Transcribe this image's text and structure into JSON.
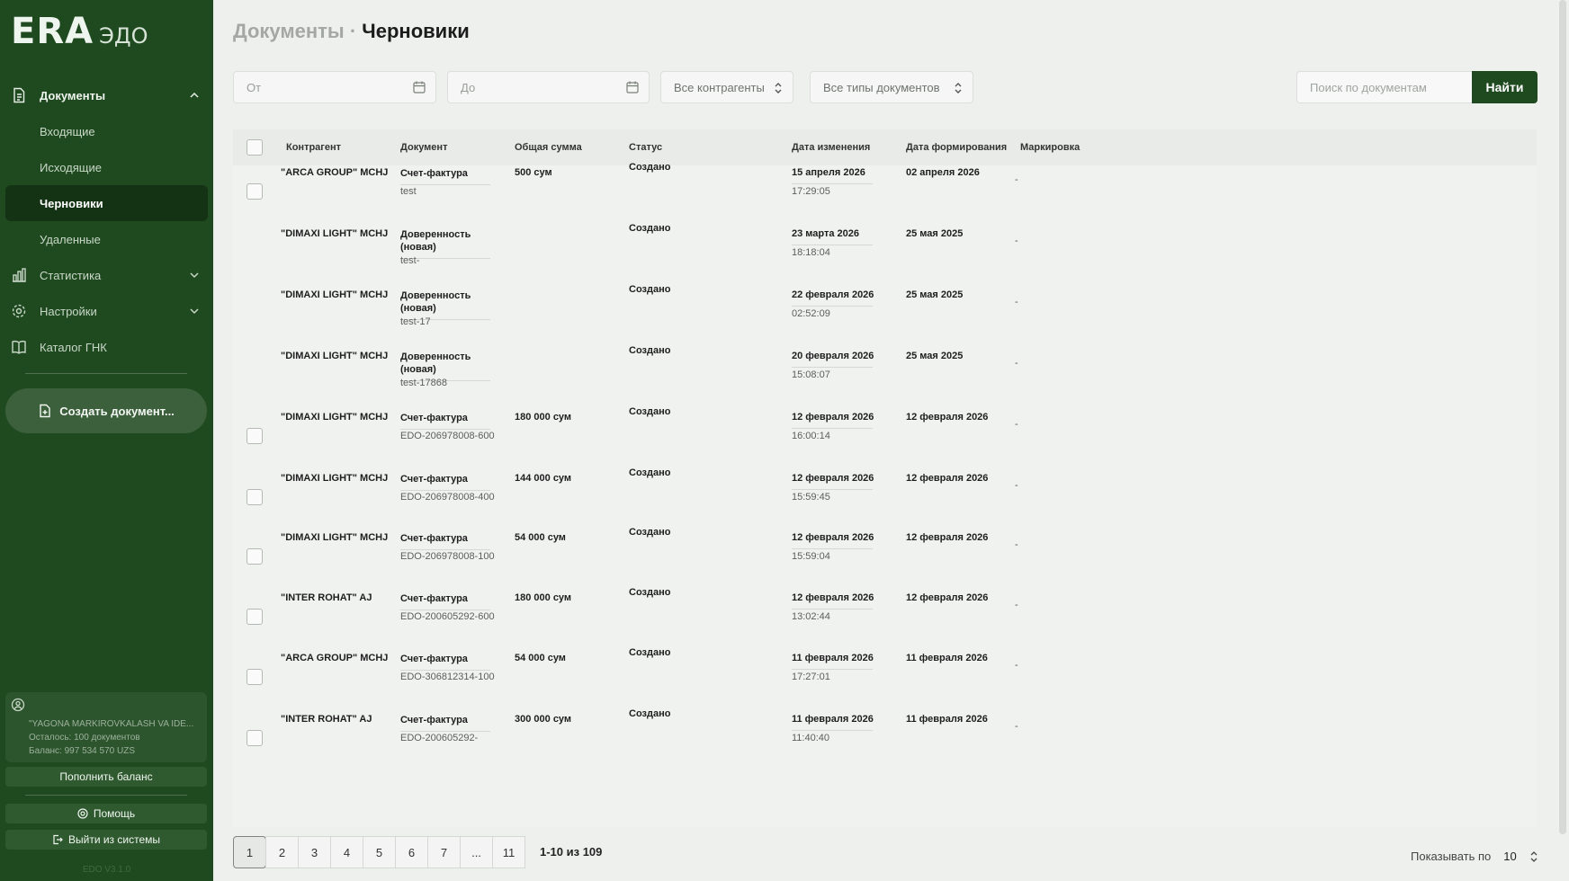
{
  "brand": {
    "logo": "ERA",
    "suffix": "ЭДО"
  },
  "sidebar": {
    "documents_label": "Документы",
    "sub": [
      "Входящие",
      "Исходящие",
      "Черновики",
      "Удаленные"
    ],
    "stats_label": "Статистика",
    "settings_label": "Настройки",
    "catalog_label": "Каталог ГНК",
    "create_label": "Создать документ...",
    "account": {
      "name": "\"YAGONA MARKIROVKALASH VA IDE...",
      "remaining": "Осталось: 100 документов",
      "balance": "Баланс: 997 534 570 UZS"
    },
    "topup_label": "Пополнить баланс",
    "help_label": "Помощь",
    "logout_label": "Выйти из системы",
    "version": "EDO V3.1.0"
  },
  "breadcrumb": {
    "section": "Документы",
    "sep": "·",
    "current": "Черновики"
  },
  "filters": {
    "from_placeholder": "От",
    "to_placeholder": "До",
    "contractors": "Все контрагенты",
    "doc_types": "Все типы документов",
    "search_placeholder": "Поиск по документам",
    "find_label": "Найти"
  },
  "table": {
    "headers": [
      "Контрагент",
      "Документ",
      "Общая сумма",
      "Статус",
      "Дата изменения",
      "Дата формирования",
      "Маркировка"
    ],
    "rows": [
      {
        "contractor": "\"ARCA GROUP\" MCHJ",
        "doc_type": "Счет-фактура",
        "doc_number": "test",
        "sum": "500 сум",
        "status": "Создано",
        "changed_date": "15 апреля 2026",
        "changed_time": "17:29:05",
        "formed_date": "02 апреля 2026",
        "marking": "-"
      },
      {
        "contractor": "\"DIMAXI LIGHT\" MCHJ",
        "doc_type": "Доверенность (новая)",
        "doc_number": "test-",
        "sum": "",
        "status": "Создано",
        "changed_date": "23 марта 2026",
        "changed_time": "18:18:04",
        "formed_date": "25 мая 2025",
        "marking": "-"
      },
      {
        "contractor": "\"DIMAXI LIGHT\" MCHJ",
        "doc_type": "Доверенность (новая)",
        "doc_number": "test-17",
        "sum": "",
        "status": "Создано",
        "changed_date": "22 февраля 2026",
        "changed_time": "02:52:09",
        "formed_date": "25 мая 2025",
        "marking": "-"
      },
      {
        "contractor": "\"DIMAXI LIGHT\" MCHJ",
        "doc_type": "Доверенность (новая)",
        "doc_number": "test-17868",
        "sum": "",
        "status": "Создано",
        "changed_date": "20 февраля 2026",
        "changed_time": "15:08:07",
        "formed_date": "25 мая 2025",
        "marking": "-"
      },
      {
        "contractor": "\"DIMAXI LIGHT\" MCHJ",
        "doc_type": "Счет-фактура",
        "doc_number": "EDO-206978008-600",
        "sum": "180 000 сум",
        "status": "Создано",
        "changed_date": "12 февраля 2026",
        "changed_time": "16:00:14",
        "formed_date": "12 февраля 2026",
        "marking": "-"
      },
      {
        "contractor": "\"DIMAXI LIGHT\" MCHJ",
        "doc_type": "Счет-фактура",
        "doc_number": "EDO-206978008-400",
        "sum": "144 000 сум",
        "status": "Создано",
        "changed_date": "12 февраля 2026",
        "changed_time": "15:59:45",
        "formed_date": "12 февраля 2026",
        "marking": "-"
      },
      {
        "contractor": "\"DIMAXI LIGHT\" MCHJ",
        "doc_type": "Счет-фактура",
        "doc_number": "EDO-206978008-100",
        "sum": "54 000 сум",
        "status": "Создано",
        "changed_date": "12 февраля 2026",
        "changed_time": "15:59:04",
        "formed_date": "12 февраля 2026",
        "marking": "-"
      },
      {
        "contractor": "\"INTER ROHAT\" AJ",
        "doc_type": "Счет-фактура",
        "doc_number": "EDO-200605292-600",
        "sum": "180 000 сум",
        "status": "Создано",
        "changed_date": "12 февраля 2026",
        "changed_time": "13:02:44",
        "formed_date": "12 февраля 2026",
        "marking": "-"
      },
      {
        "contractor": "\"ARCA GROUP\" MCHJ",
        "doc_type": "Счет-фактура",
        "doc_number": "EDO-306812314-100",
        "sum": "54 000 сум",
        "status": "Создано",
        "changed_date": "11 февраля 2026",
        "changed_time": "17:27:01",
        "formed_date": "11 февраля 2026",
        "marking": "-"
      },
      {
        "contractor": "\"INTER ROHAT\" AJ",
        "doc_type": "Счет-фактура",
        "doc_number": "EDO-200605292-",
        "sum": "300 000 сум",
        "status": "Создано",
        "changed_date": "11 февраля 2026",
        "changed_time": "11:40:40",
        "formed_date": "11 февраля 2026",
        "marking": "-"
      }
    ]
  },
  "pagination": {
    "pages": [
      "1",
      "2",
      "3",
      "4",
      "5",
      "6",
      "7",
      "...",
      "11"
    ],
    "current": "1",
    "info": "1-10 из 109",
    "per_page_label": "Показывать по",
    "per_page_value": "10"
  }
}
